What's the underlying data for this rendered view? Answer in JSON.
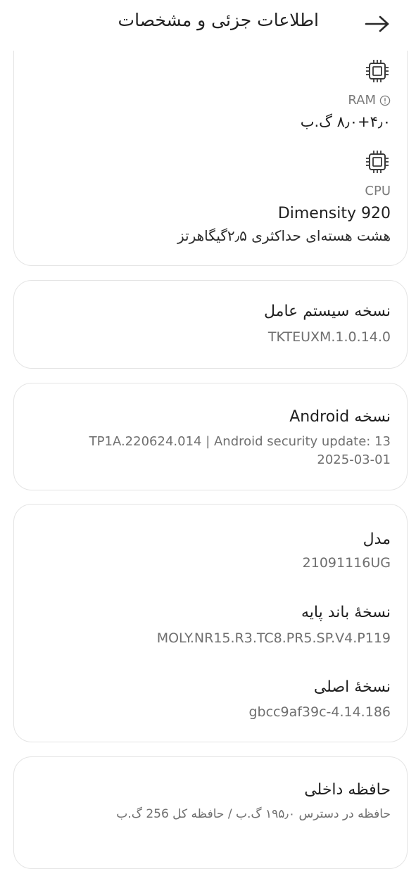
{
  "header": {
    "title": "اطلاعات جزئی و مشخصات",
    "back_icon": "arrow-right-icon"
  },
  "specs": {
    "ram": {
      "icon": "chip-icon",
      "label": "RAM",
      "info_icon": "info-icon",
      "value": "۸٫۰+۴٫۰ گ.ب"
    },
    "cpu": {
      "icon": "chip-icon",
      "label": "CPU",
      "name": "Dimensity 920",
      "detail": "هشت هسته‌ای حداکثری ۲٫۵گیگاهرتز"
    }
  },
  "os_version": {
    "title": "نسخه سیستم عامل",
    "value": "TKTEUXM.1.0.14.0"
  },
  "android_version": {
    "title": "نسخه Android",
    "line1": "TP1A.220624.014 | Android security update: 13",
    "line2": "2025-03-01"
  },
  "device_info": {
    "model_title": "مدل",
    "model_value": "21091116UG",
    "baseband_title": "نسخهٔ باند پایه",
    "baseband_value": "MOLY.NR15.R3.TC8.PR5.SP.V4.P119",
    "kernel_title": "نسخهٔ اصلی",
    "kernel_value": "gbcc9af39c-4.14.186"
  },
  "storage": {
    "title": "حافظه داخلی",
    "detail": "حافظه در دسترس ۱۹۵٫۰ گ.ب / حافظه کل 256 گ.ب"
  },
  "colors": {
    "background": "#ffffff",
    "card_border": "#e4e4e4",
    "text_primary": "#1f1f1f",
    "text_secondary": "#6f6f6f"
  }
}
